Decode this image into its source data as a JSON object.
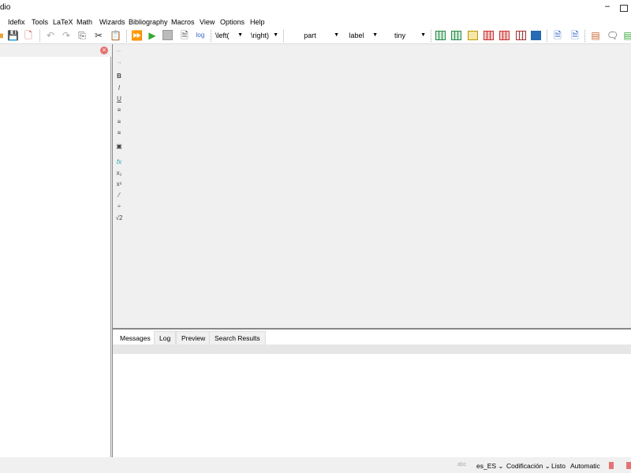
{
  "window": {
    "title": "dio",
    "minimize": "–"
  },
  "menu": [
    "Idefix",
    "Tools",
    "LaTeX",
    "Math",
    "Wizards",
    "Bibliography",
    "Macros",
    "View",
    "Options",
    "Help"
  ],
  "toolbar": {
    "left_delim": "\\left(",
    "right_delim": "\\right)",
    "sectioning": "part",
    "reference": "label",
    "size": "tiny"
  },
  "side_toolbar": {
    "left": "←",
    "right": "→",
    "bold": "B",
    "italic": "I",
    "underline": "U",
    "fx": "fx",
    "subscript": "x₁",
    "superscript": "x¹",
    "sqrt": "√2"
  },
  "bottom_tabs": [
    "Messages",
    "Log",
    "Preview",
    "Search Results"
  ],
  "active_tab": "Messages",
  "status": {
    "language": "es_ES",
    "encoding": "Codificación",
    "state": "Listo",
    "mode": "Automatic"
  },
  "colors": {
    "accent_green": "#2a8a4a",
    "accent_red": "#e57373"
  }
}
